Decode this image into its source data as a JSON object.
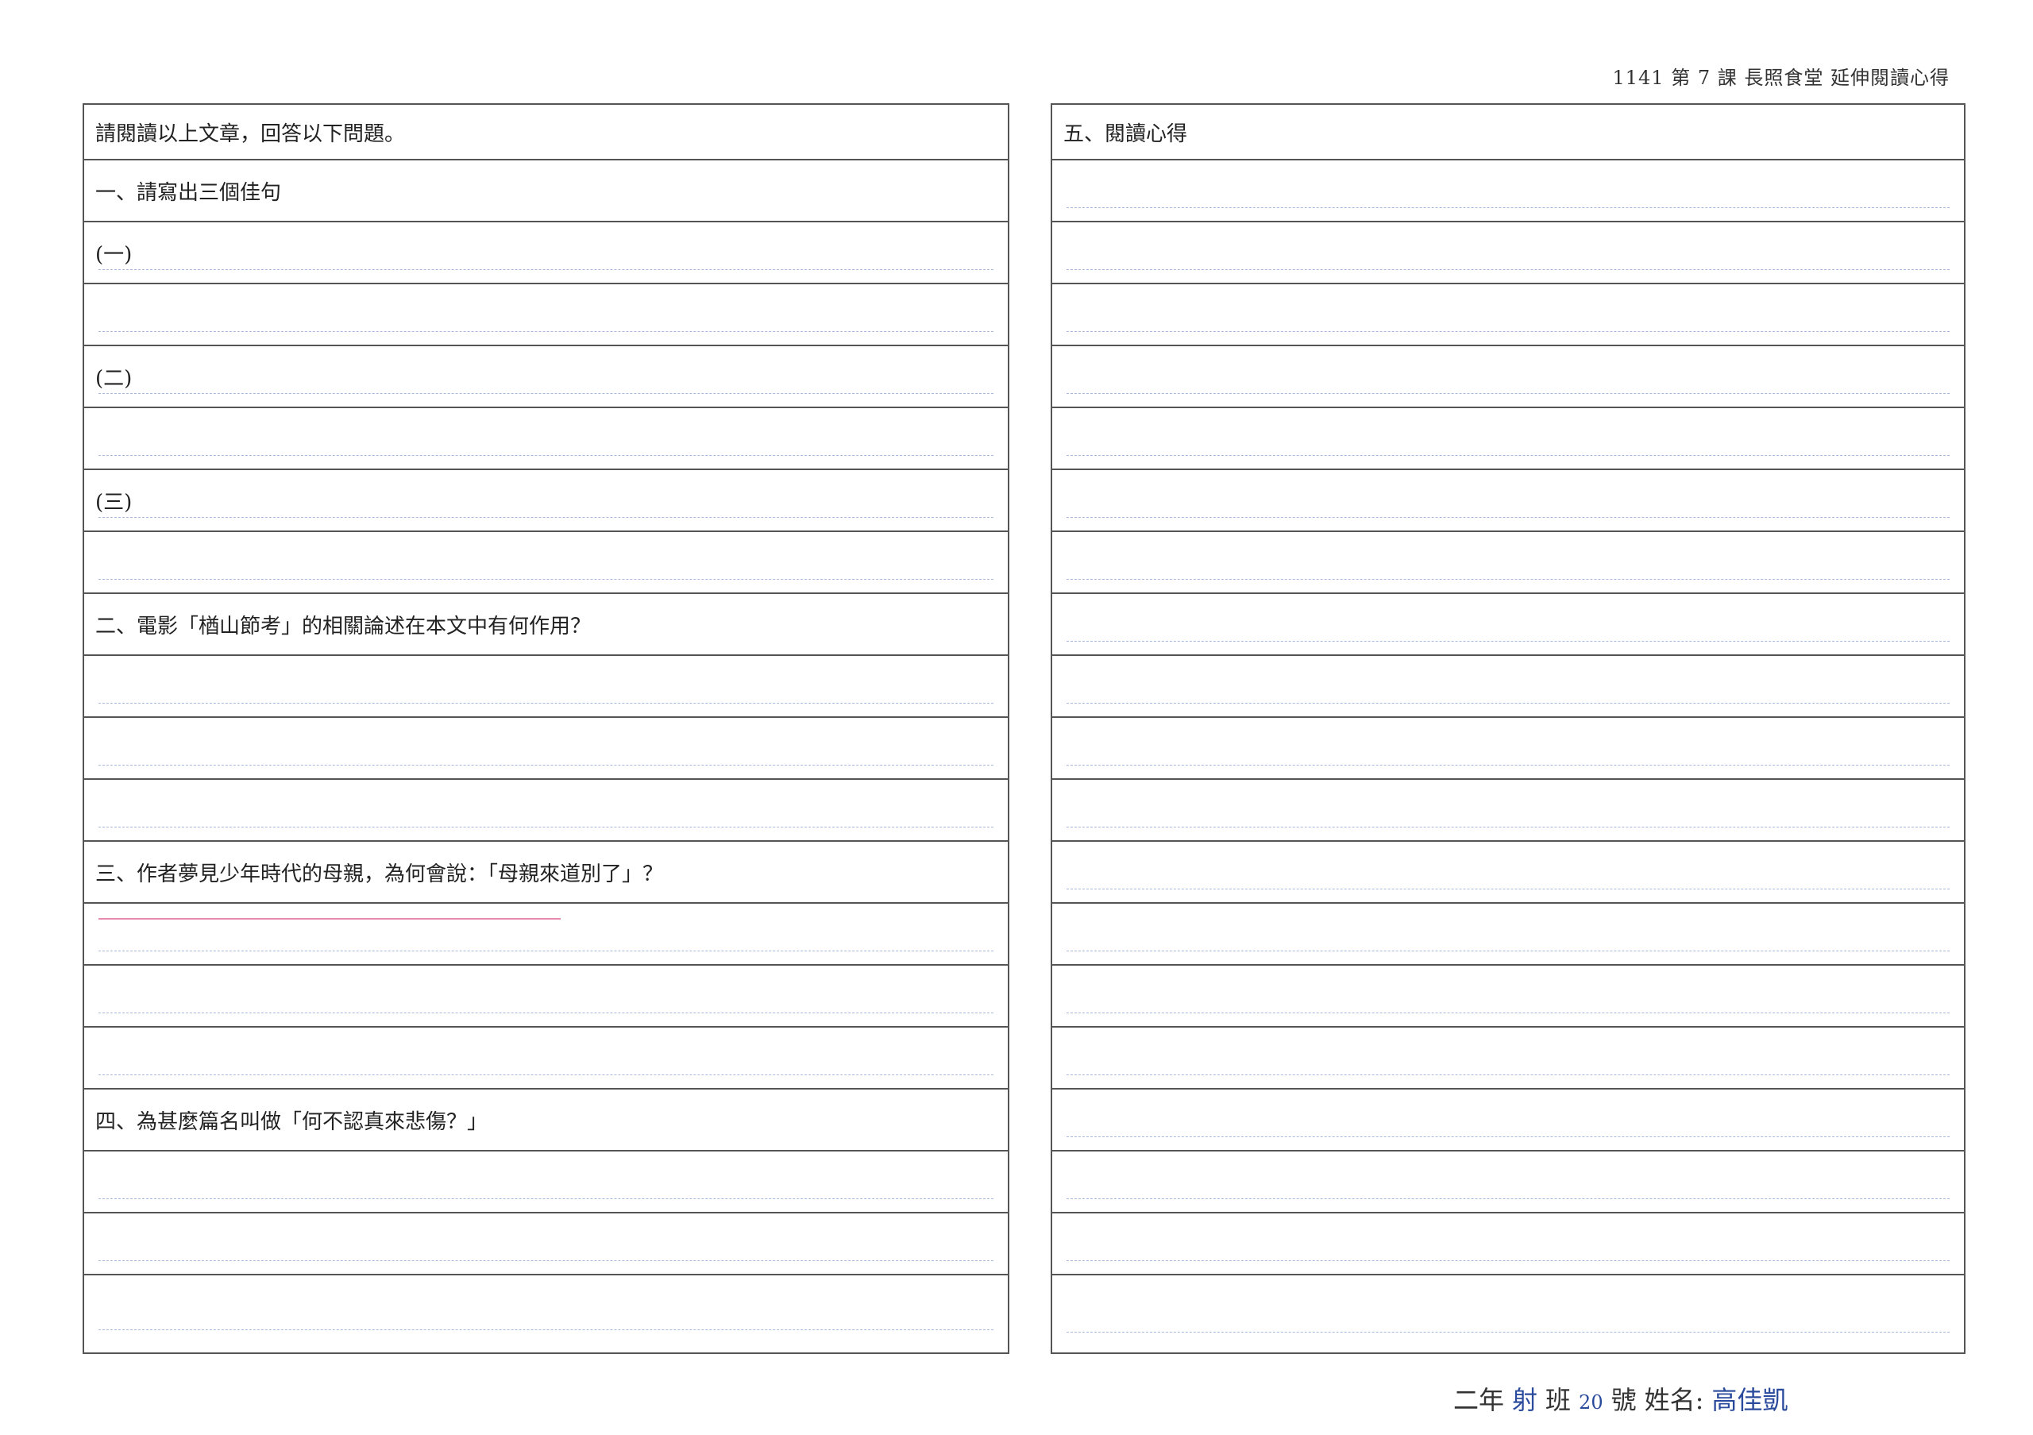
{
  "header": {
    "title": "1141 第 7 課  長照食堂  延伸閱讀心得"
  },
  "left": {
    "intro": "請閱讀以上文章，回答以下問題。",
    "q1": "一、請寫出三個佳句",
    "q1_item1": "(一)",
    "q1_item2": "(二)",
    "q1_item3": "(三)",
    "q2": "二、電影「楢山節考」的相關論述在本文中有何作用？",
    "q3": "三、作者夢見少年時代的母親，為何會說：「母親來道別了」？",
    "q4": "四、為甚麼篇名叫做「何不認真來悲傷？」"
  },
  "right": {
    "q5": "五、閱讀心得"
  },
  "footer": {
    "grade": "二年",
    "class_name": "射",
    "class_label": "班",
    "seat_no": "20",
    "seat_label": "號",
    "name_label": "姓名:",
    "name": "高佳凱"
  },
  "colors": {
    "ink": "#2a4a9c",
    "marker": "#d6286e",
    "border": "#555555"
  }
}
